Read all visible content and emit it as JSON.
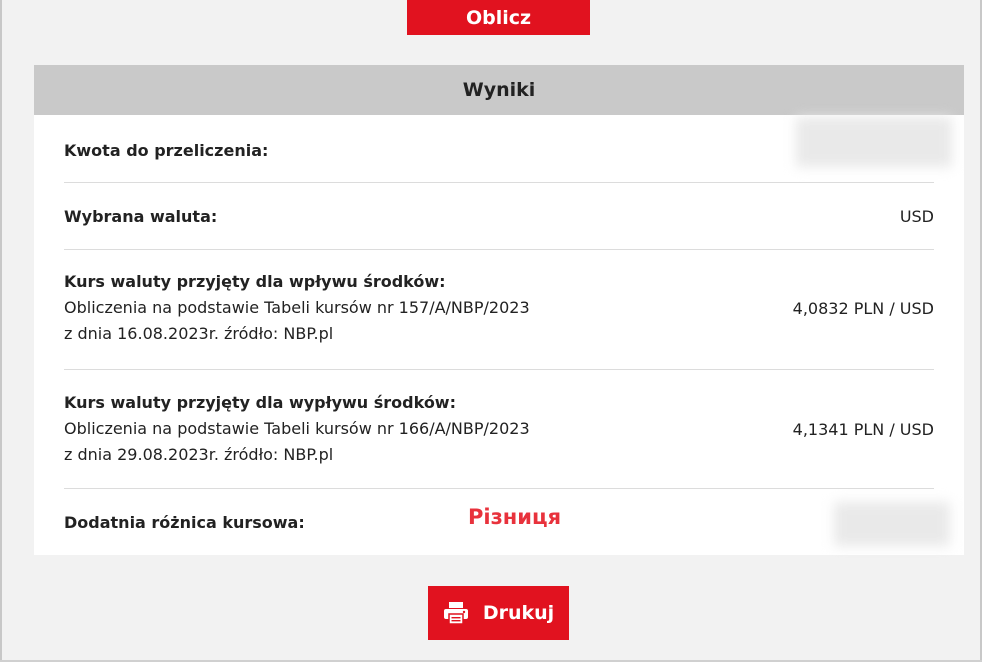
{
  "calculate_button": {
    "label": "Oblicz"
  },
  "results": {
    "title": "Wyniki",
    "rows": [
      {
        "label": "Kwota do przeliczenia:",
        "value": ""
      },
      {
        "label": "Wybrana waluta:",
        "value": "USD"
      },
      {
        "label": "Kurs waluty przyjęty dla wpływu środków:",
        "detail_line1": "Obliczenia na podstawie Tabeli kursów nr 157/A/NBP/2023",
        "detail_line2": "z dnia 16.08.2023r. źródło: NBP.pl",
        "value": "4,0832 PLN / USD"
      },
      {
        "label": "Kurs waluty przyjęty dla wypływu środków:",
        "detail_line1": "Obliczenia na podstawie Tabeli kursów nr 166/A/NBP/2023",
        "detail_line2": "z dnia 29.08.2023r. źródło: NBP.pl",
        "value": "4,1341 PLN / USD"
      },
      {
        "label": "Dodatnia różnica kursowa:",
        "value": ""
      }
    ]
  },
  "annotation": {
    "text": "Різниця",
    "color": "#e8323c"
  },
  "print_button": {
    "label": "Drukuj",
    "icon": "printer-icon"
  },
  "colors": {
    "accent": "#e1121f",
    "header_bg": "#c9c9c9"
  }
}
